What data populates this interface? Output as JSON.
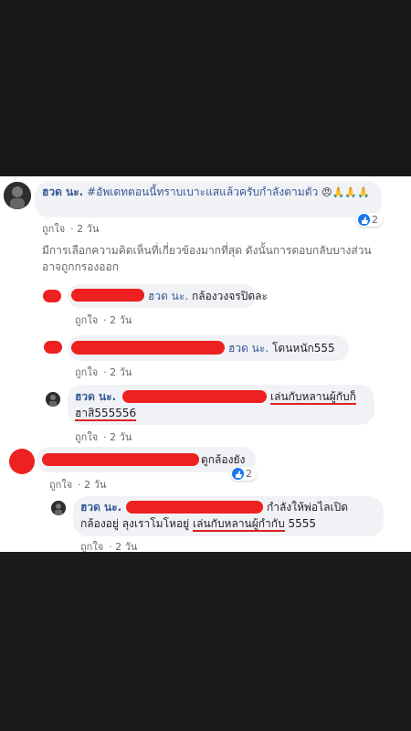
{
  "top_comment": {
    "author": "ฮวด นะ.",
    "text": "#อัพเดทตอนนี้ทราบเบาะแสแล้วครับกำลังตามตัว",
    "emoji": "😠🙏🙏🙏",
    "like_label": "ถูกใจ",
    "time": "2 วัน",
    "reaction_count": "2"
  },
  "notice": "มีการเลือกความคิดเห็นที่เกี่ยวข้องมากที่สุด ดังนั้นการตอบกลับบางส่วนอาจถูกกรองออก",
  "replies": [
    {
      "mention": "ฮวด นะ.",
      "text": "กล้องวงจรปิดละ",
      "like_label": "ถูกใจ",
      "time": "2 วัน"
    },
    {
      "mention": "ฮวด นะ.",
      "text": "โดนหนัก555",
      "like_label": "ถูกใจ",
      "time": "2 วัน"
    },
    {
      "author": "ฮวด นะ.",
      "text": "เล่นกับหลานผู้กับก็",
      "text2": "ฮาสิ555556",
      "like_label": "ถูกใจ",
      "time": "2 วัน"
    }
  ],
  "second_comment": {
    "text": "ดูกล้องยัง",
    "like_label": "ถูกใจ",
    "time": "2 วัน",
    "reaction_count": "2"
  },
  "second_reply": {
    "author": "ฮวด นะ.",
    "text": "กำลังให้พ่อไลเปิด",
    "text2_a": "กล้องอยู่ ลุงเราโมโหอยู่",
    "text2_b": "เล่นกับหลานผู้กำกับ",
    "text2_c": "5555",
    "like_label": "ถูกใจ",
    "time": "2 วัน"
  },
  "icons": [
    "like-icon",
    "avatar-icon"
  ],
  "colors": {
    "redact": "#ee2020",
    "link": "#385898",
    "like": "#1877f2"
  }
}
